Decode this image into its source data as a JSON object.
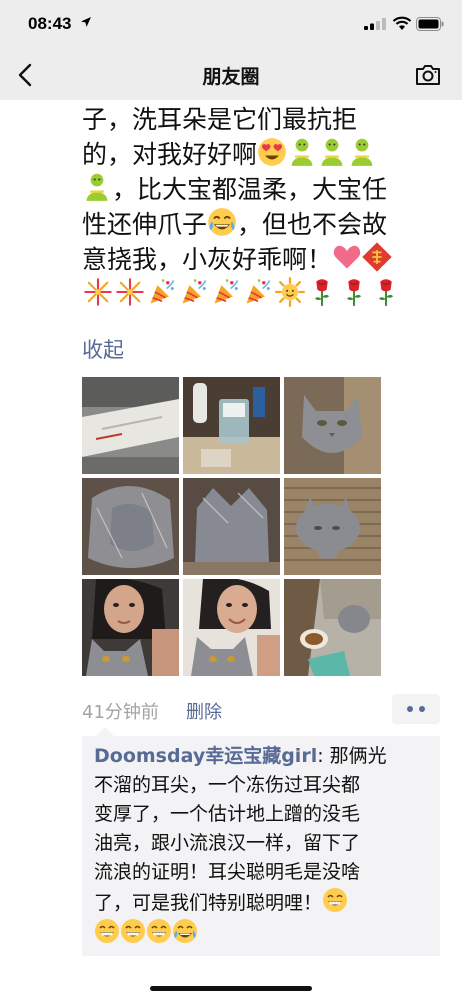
{
  "status_bar": {
    "time": "08:43"
  },
  "nav": {
    "title": "朋友圈"
  },
  "post": {
    "lines": [
      {
        "text": "子，洗耳朵是它们最抗拒",
        "emojis": []
      },
      {
        "text": "的，对我好好啊",
        "emojis": [
          "heart-eyes",
          "person",
          "person",
          "person"
        ]
      },
      {
        "text": "，比大宝都温柔，大宝任",
        "emojis_before": [
          "person"
        ]
      },
      {
        "text_a": "性还伸爪子",
        "emoji_mid": "joy",
        "text_b": "，但也不会故"
      },
      {
        "text": "意挠我，小灰好乖啊！",
        "emojis": [
          "heart",
          "fu"
        ]
      },
      {
        "text": "",
        "emojis": [
          "fireworks",
          "fireworks",
          "party",
          "party",
          "party",
          "party",
          "sun",
          "rose",
          "rose",
          "rose"
        ]
      }
    ],
    "collapse_label": "收起",
    "photos": [
      "ear-cleaner-box",
      "cotton-jar",
      "gray-cat-face",
      "cat-in-plastic",
      "cat-head-wrapped",
      "cat-lying",
      "woman-with-cat",
      "woman-with-cat-smiling",
      "cat-food-bowl"
    ],
    "time": "41分钟前",
    "delete_label": "删除"
  },
  "comment": {
    "author": "Doomsday幸运宝藏girl",
    "lines": [
      {
        "text": ": 那俩光",
        "emojis": []
      },
      {
        "text": "不溜的耳尖，一个冻伤过耳尖都",
        "emojis": []
      },
      {
        "text": "变厚了，一个估计地上蹭的没毛",
        "emojis": []
      },
      {
        "text": "油亮，跟小流浪汉一样，留下了",
        "emojis": []
      },
      {
        "text": "流浪的证明！耳尖聪明毛是没啥",
        "emojis": []
      },
      {
        "text": "了，可是我们特别聪明哩！",
        "emojis": [
          "grin"
        ]
      },
      {
        "text": "",
        "emojis": [
          "grin",
          "grin",
          "grin",
          "joy"
        ]
      }
    ]
  },
  "colors": {
    "link": "#576b95",
    "nav_bg": "#ededed",
    "comment_bg": "#f3f3f5",
    "meta_gray": "#a3a3a3"
  }
}
